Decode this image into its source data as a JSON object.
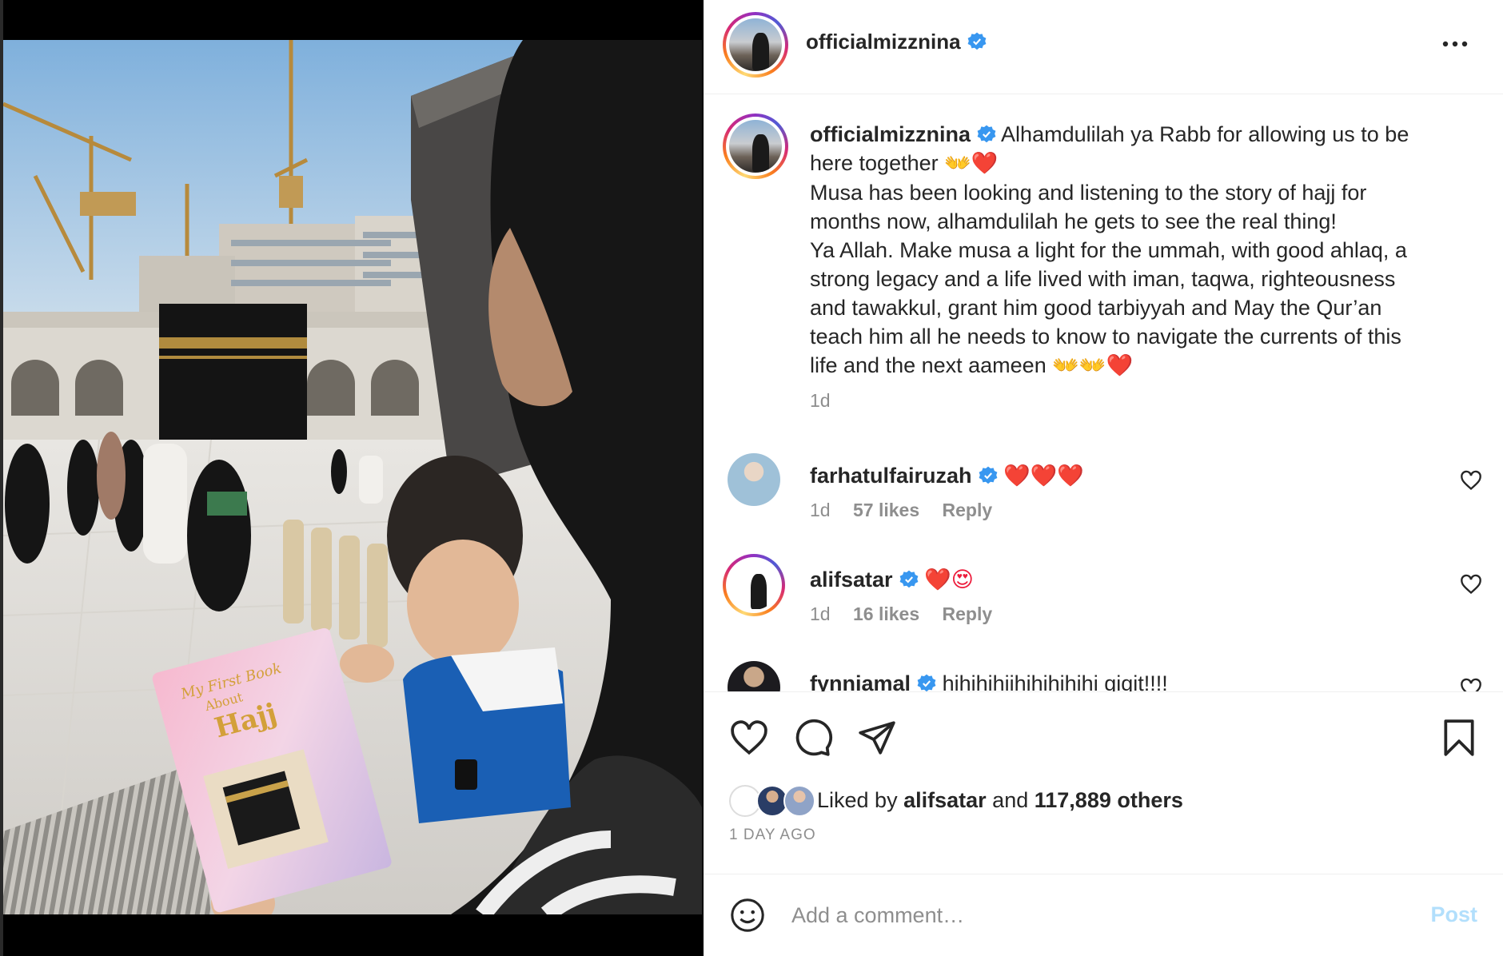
{
  "post": {
    "username": "officialmizznina",
    "verified_icon": "verified-badge-icon",
    "more_icon": "more-options-icon"
  },
  "caption": {
    "username": "officialmizznina",
    "line1": "Alhamdulilah ya Rabb for allowing us to be",
    "line2": "here together",
    "line2_emoji": "👐❤️",
    "line3": "Musa has been looking and listening to the story of hajj for",
    "line4": "months now, alhamdulilah he gets to see the real thing!",
    "line5": "Ya Allah. Make musa a light for the ummah, with good ahlaq, a",
    "line6": "strong legacy and a life lived with iman, taqwa, righteousness",
    "line7": "and tawakkul, grant him good tarbiyyah and May the Qur’an",
    "line8": "teach him all he needs to know to navigate the currents of this",
    "line9": "life and the next aameen",
    "line9_emoji": "👐👐❤️",
    "time": "1d"
  },
  "comments": [
    {
      "username": "farhatulfairuzah",
      "text": "❤️❤️❤️",
      "time": "1d",
      "likes": "57 likes",
      "reply": "Reply"
    },
    {
      "username": "alifsatar",
      "text": "❤️😍",
      "time": "1d",
      "likes": "16 likes",
      "reply": "Reply"
    },
    {
      "username": "fynniamal",
      "text": "hihihihiihihihihihi gigit!!!!"
    }
  ],
  "likes": {
    "prefix": "Liked by",
    "user": "alifsatar",
    "joiner": "and",
    "count": "117,889 others"
  },
  "date": "1 DAY AGO",
  "add_comment": {
    "placeholder": "Add a comment…",
    "post_label": "Post"
  },
  "colors": {
    "verified": "#3897f0",
    "heart": "#ed1c3c",
    "post_disabled": "#b2dffc",
    "muted": "#8e8e8e"
  },
  "photo": {
    "book_title": "My First Book About Hajj"
  }
}
